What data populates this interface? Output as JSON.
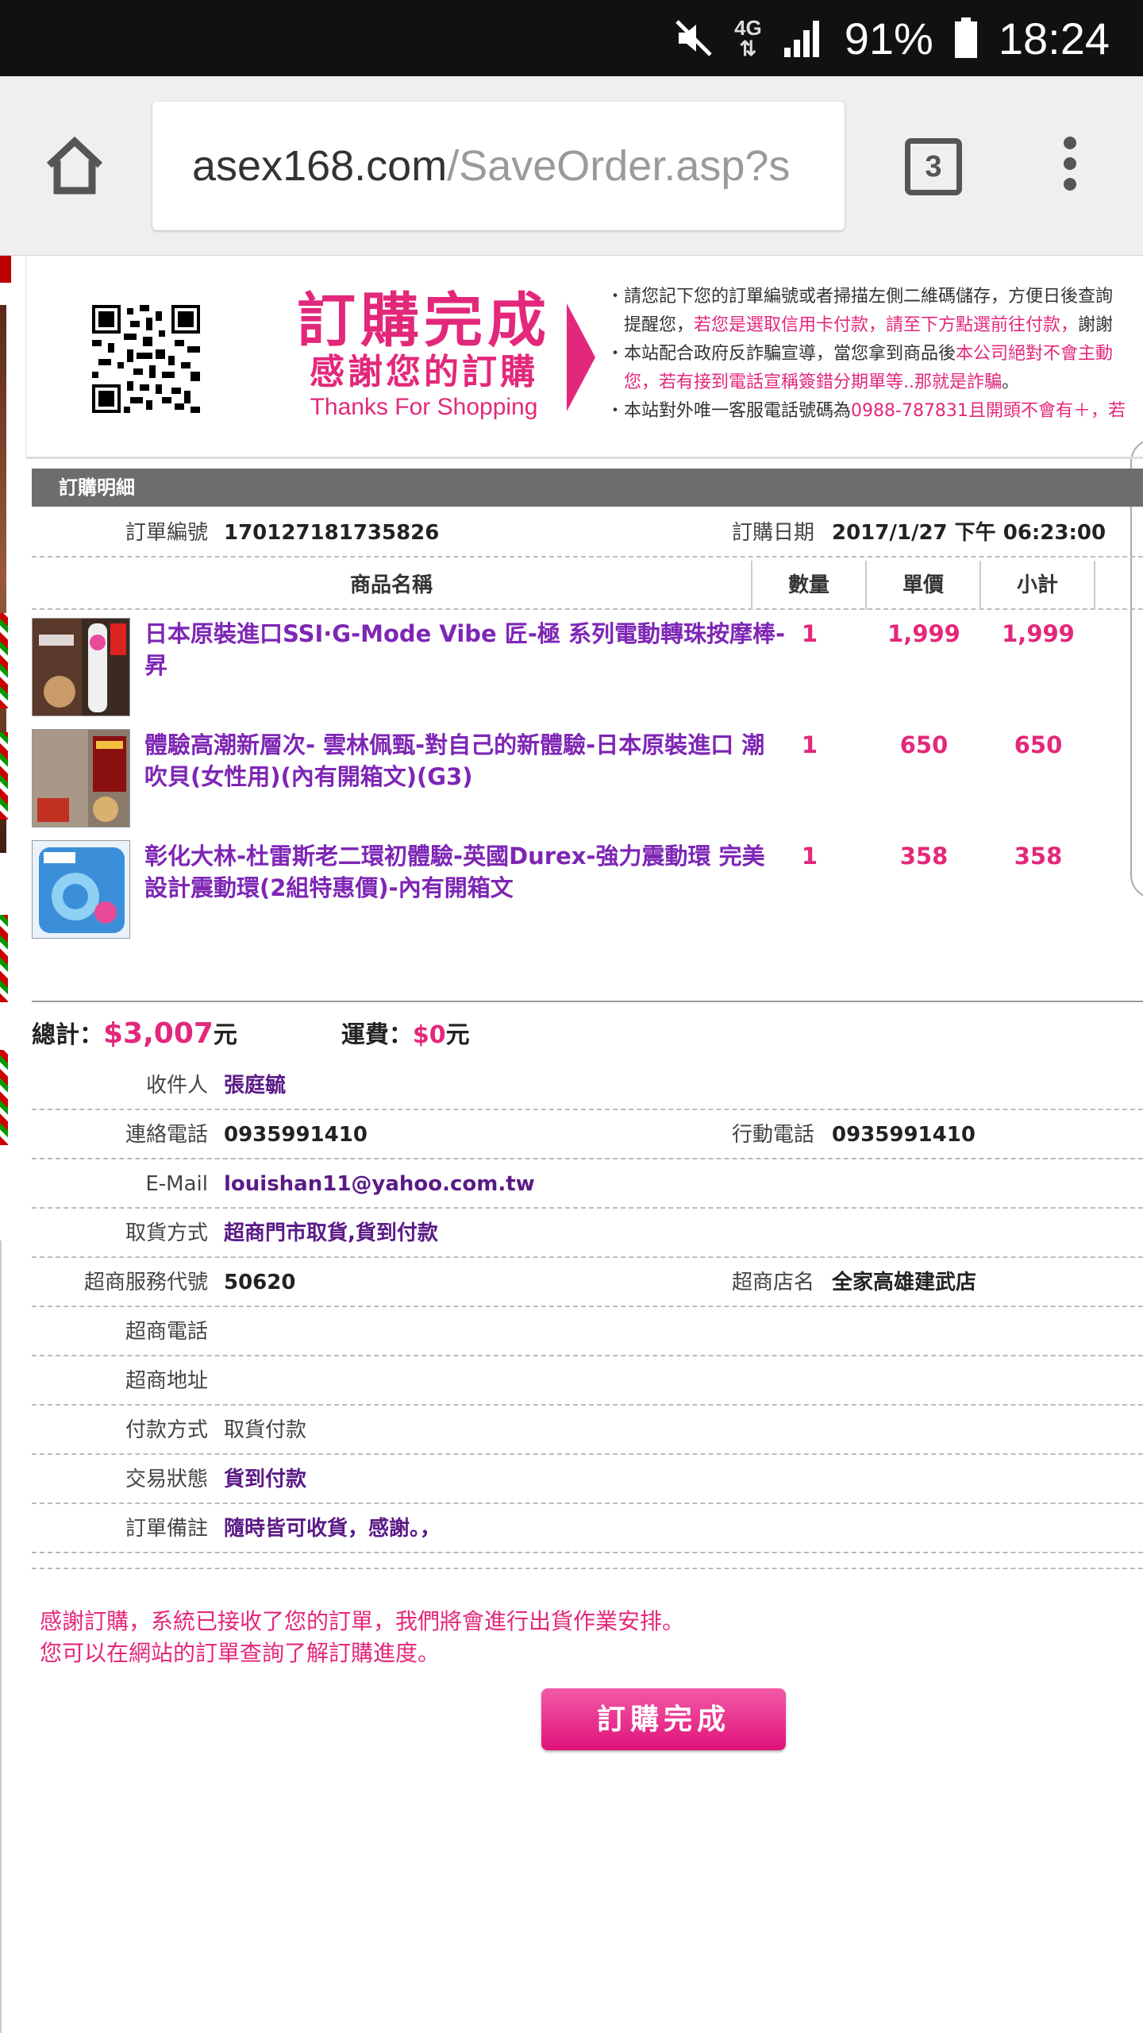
{
  "status_bar": {
    "network": "4G",
    "battery": "91%",
    "time": "18:24"
  },
  "browser": {
    "url_host": "asex168.com",
    "url_path": "/SaveOrder.asp?s",
    "tab_count": "3"
  },
  "banner": {
    "title_main": "訂購完成",
    "title_sub": "感謝您的訂購",
    "title_en": "Thanks For Shopping",
    "notice_lines": [
      {
        "text": "・請您記下您的訂單編號或者掃描左側二維碼儲存，方便日後查詢",
        "highlight": ""
      },
      {
        "text": "　提醒您，",
        "highlight": "若您是選取信用卡付款，請至下方點選前往付款，",
        "tail": "謝謝"
      },
      {
        "text": "・本站配合政府反詐騙宣導，當您拿到商品後",
        "highlight": "本公司絕對不會主動",
        "tail": ""
      },
      {
        "text": "　您，若有接到電話宣稱",
        "highlight": "簽錯分期單等..那就是詐騙",
        "tail": "。"
      },
      {
        "text": "・本站對外唯一客服電話號碼為",
        "highlight": "0988-787831",
        "tail": "且開頭不會有＋，若"
      }
    ]
  },
  "order": {
    "section_title": "訂購明細",
    "order_no_label": "訂單編號",
    "order_no": "170127181735826",
    "order_date_label": "訂購日期",
    "order_date": "2017/1/27 下午 06:23:00",
    "columns": {
      "name": "商品名稱",
      "qty": "數量",
      "price": "單價",
      "subtotal": "小計"
    },
    "items": [
      {
        "name": "日本原裝進口SSI·G-Mode Vibe 匠-極 系列電動轉珠按摩棒- 昇",
        "qty": "1",
        "price": "1,999",
        "subtotal": "1,999"
      },
      {
        "name": "體驗高潮新層次- 雲林佩甄-對自己的新體驗-日本原裝進口 潮吹貝(女性用)(內有開箱文)(G3)",
        "qty": "1",
        "price": "650",
        "subtotal": "650"
      },
      {
        "name": "彰化大林-杜雷斯老二環初體驗-英國Durex-強力震動環 完美設計震動環(2組特惠價)-內有開箱文",
        "qty": "1",
        "price": "358",
        "subtotal": "358"
      }
    ],
    "total_label": "總計：",
    "total": "$3,007",
    "total_unit": "元",
    "shipping_label": "運費：",
    "shipping": "$0",
    "shipping_unit": "元"
  },
  "recipient": {
    "name_label": "收件人",
    "name": "張庭毓",
    "phone_label": "連絡電話",
    "phone": "0935991410",
    "mobile_label": "行動電話",
    "mobile": "0935991410",
    "email_label": "E-Mail",
    "email": "louishan11@yahoo.com.tw",
    "pickup_label": "取貨方式",
    "pickup": "超商門市取貨,貨到付款",
    "store_code_label": "超商服務代號",
    "store_code": "50620",
    "store_name_label": "超商店名",
    "store_name": "全家高雄建武店",
    "store_phone_label": "超商電話",
    "store_phone": "",
    "store_addr_label": "超商地址",
    "store_addr": "",
    "payment_label": "付款方式",
    "payment": "取貨付款",
    "status_label": "交易狀態",
    "status": "貨到付款",
    "note_label": "訂單備註",
    "note": "隨時皆可收貨，感謝。，"
  },
  "footer": {
    "thanks_line1": "感謝訂購，系統已接收了您的訂單，我們將會進行出貨作業安排。",
    "thanks_line2": "您可以在網站的訂單查詢了解訂購進度。",
    "complete_button": "訂購完成"
  },
  "colors": {
    "accent_pink": "#e3287b",
    "item_purple": "#7e26b5",
    "value_purple": "#5a1a86",
    "header_gray": "#6d6d6d"
  },
  "icons": [
    "mute-icon",
    "signal-icon",
    "battery-icon",
    "home-icon",
    "tabs-icon",
    "overflow-menu-icon",
    "qr-code-icon"
  ]
}
